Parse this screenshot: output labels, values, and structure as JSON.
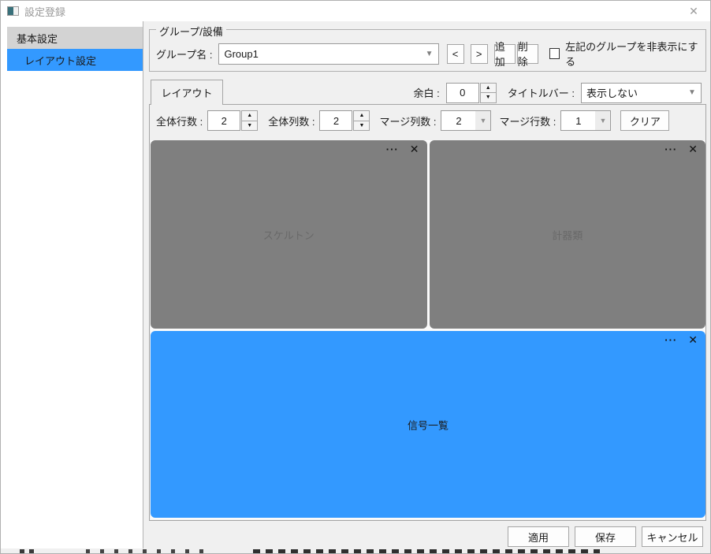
{
  "window": {
    "title": "設定登録",
    "close_glyph": "✕"
  },
  "sidebar": {
    "items": [
      {
        "label": "基本設定",
        "selected": false
      },
      {
        "label": "レイアウト設定",
        "selected": true
      }
    ]
  },
  "group_section": {
    "legend": "グループ/設備",
    "group_name_label": "グループ名 :",
    "group_name_value": "Group1",
    "prev_button": "<",
    "next_button": ">",
    "add_button": "追加",
    "delete_button": "削除",
    "hide_checkbox_label": "左記のグループを非表示にする",
    "hide_checkbox_checked": false
  },
  "layout_tab": {
    "label": "レイアウト"
  },
  "header_controls": {
    "margin_label": "余白 :",
    "margin_value": "0",
    "titlebar_label": "タイトルバー :",
    "titlebar_value": "表示しない"
  },
  "grid_controls": {
    "rows_label": "全体行数 :",
    "rows_value": "2",
    "cols_label": "全体列数 :",
    "cols_value": "2",
    "merge_cols_label": "マージ列数 :",
    "merge_cols_value": "2",
    "merge_rows_label": "マージ行数 :",
    "merge_rows_value": "1",
    "clear_button": "クリア"
  },
  "icons": {
    "dropdown_arrow": "▼",
    "spin_up": "▲",
    "spin_down": "▼",
    "panel_menu": "···",
    "panel_close": "✕"
  },
  "panels": [
    {
      "label": "スケルトン",
      "color": "#7f7f7f",
      "label_color": "#696969"
    },
    {
      "label": "計器類",
      "color": "#7f7f7f",
      "label_color": "#696969"
    },
    {
      "label": "信号一覧",
      "color": "#3399ff",
      "label_color": "#1c1c1c"
    }
  ],
  "footer": {
    "apply_button": "適用",
    "save_button": "保存",
    "cancel_button": "キャンセル"
  },
  "colors": {
    "accent_blue": "#3399ff",
    "panel_gray": "#7f7f7f",
    "background": "#f0f0f0",
    "sidebar_item_gray": "#d3d3d3"
  }
}
